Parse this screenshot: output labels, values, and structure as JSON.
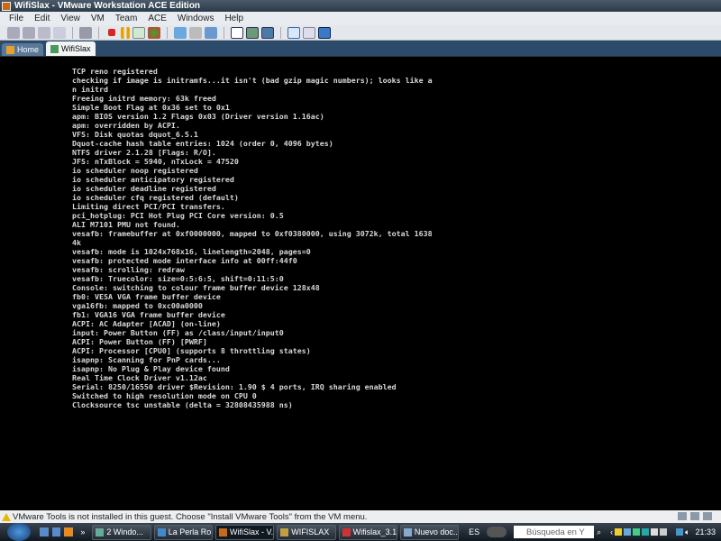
{
  "window": {
    "title": "WifiSlax - VMware Workstation ACE Edition"
  },
  "menu": [
    "File",
    "Edit",
    "View",
    "VM",
    "Team",
    "ACE",
    "Windows",
    "Help"
  ],
  "tabs": [
    {
      "label": "Home"
    },
    {
      "label": "WifiSlax"
    }
  ],
  "console_lines": [
    "TCP reno registered",
    "checking if image is initramfs...it isn't (bad gzip magic numbers); looks like a",
    "n initrd",
    "Freeing initrd memory: 63k freed",
    "Simple Boot Flag at 0x36 set to 0x1",
    "apm: BIOS version 1.2 Flags 0x03 (Driver version 1.16ac)",
    "apm: overridden by ACPI.",
    "VFS: Disk quotas dquot_6.5.1",
    "Dquot-cache hash table entries: 1024 (order 0, 4096 bytes)",
    "NTFS driver 2.1.28 [Flags: R/O].",
    "JFS: nTxBlock = 5940, nTxLock = 47520",
    "io scheduler noop registered",
    "io scheduler anticipatory registered",
    "io scheduler deadline registered",
    "io scheduler cfq registered (default)",
    "Limiting direct PCI/PCI transfers.",
    "pci_hotplug: PCI Hot Plug PCI Core version: 0.5",
    "ALI M7101 PMU not found.",
    "vesafb: framebuffer at 0xf0000000, mapped to 0xf0380000, using 3072k, total 1638",
    "4k",
    "vesafb: mode is 1024x768x16, linelength=2048, pages=0",
    "vesafb: protected mode interface info at 00ff:44f0",
    "vesafb: scrolling: redraw",
    "vesafb: Truecolor: size=0:5:6:5, shift=0:11:5:0",
    "Console: switching to colour frame buffer device 128x48",
    "fb0: VESA VGA frame buffer device",
    "vga16fb: mapped to 0xc00a0000",
    "fb1: VGA16 VGA frame buffer device",
    "ACPI: AC Adapter [ACAD] (on-line)",
    "input: Power Button (FF) as /class/input/input0",
    "ACPI: Power Button (FF) [PWRF]",
    "ACPI: Processor [CPU0] (supports 8 throttling states)",
    "isapnp: Scanning for PnP cards...",
    "isapnp: No Plug & Play device found",
    "Real Time Clock Driver v1.12ac",
    "Serial: 8250/16550 driver $Revision: 1.90 $ 4 ports, IRQ sharing enabled",
    "Switched to high resolution mode on CPU 0",
    "Clocksource tsc unstable (delta = 32808435988 ns)"
  ],
  "status": {
    "message": "VMware Tools is not installed in this guest. Choose \"Install VMware Tools\" from the VM menu."
  },
  "taskbar": {
    "tasks": [
      "2 Windo...",
      "La Perla Ro...",
      "WifiSlax - V...",
      "WIFISLAX",
      "Wifislax_3.1...",
      "Nuevo doc..."
    ],
    "language": "ES",
    "search_placeholder": "Búsqueda en Y",
    "clock": "21:33"
  }
}
